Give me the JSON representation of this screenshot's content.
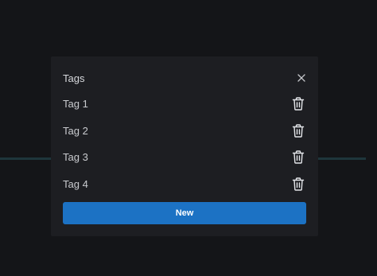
{
  "dialog": {
    "title": "Tags",
    "tags": [
      {
        "label": "Tag 1"
      },
      {
        "label": "Tag 2"
      },
      {
        "label": "Tag 3"
      },
      {
        "label": "Tag 4"
      }
    ],
    "new_label": "New"
  },
  "colors": {
    "background": "#141518",
    "modal": "#1d1e22",
    "accent": "#1c72c4",
    "text": "#c9cbcf"
  },
  "icons": {
    "close": "close-icon",
    "delete": "trash-icon"
  }
}
